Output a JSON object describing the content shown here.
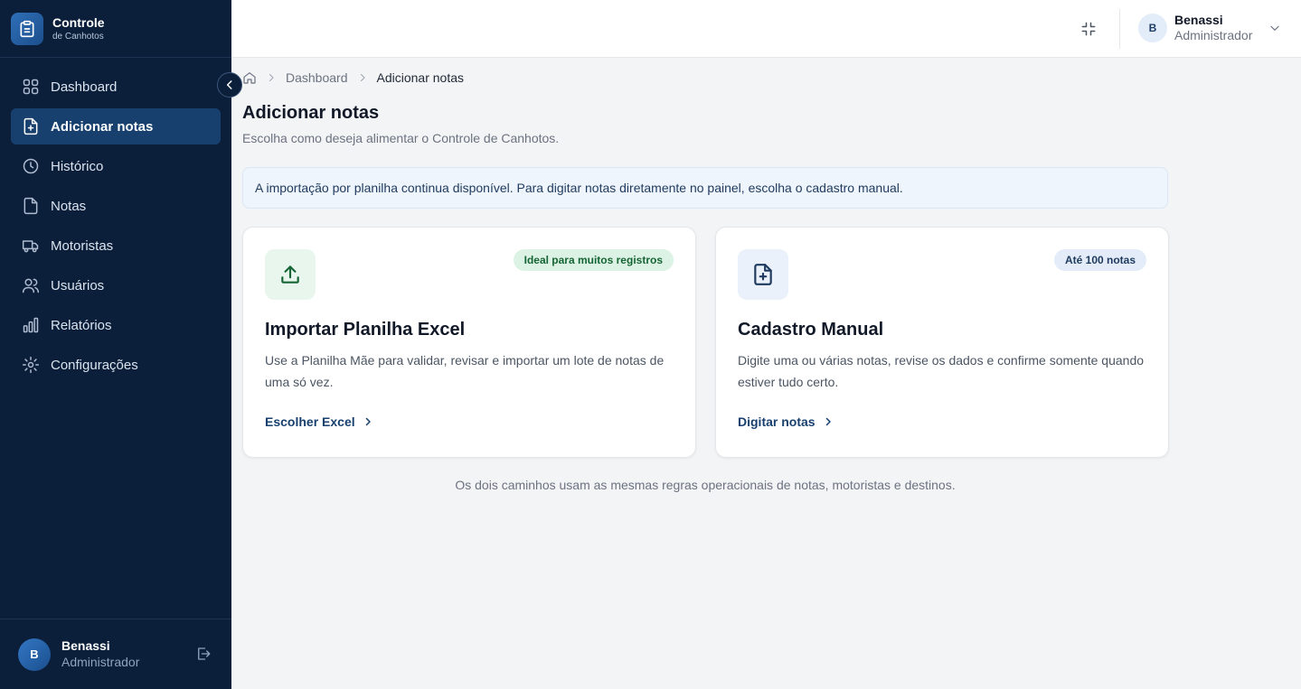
{
  "brand": {
    "title": "Controle",
    "subtitle": "de Canhotos"
  },
  "sidebar": {
    "items": [
      {
        "label": "Dashboard",
        "icon": "dashboard-icon",
        "active": false
      },
      {
        "label": "Adicionar notas",
        "icon": "file-plus-icon",
        "active": true
      },
      {
        "label": "Histórico",
        "icon": "clock-icon",
        "active": false
      },
      {
        "label": "Notas",
        "icon": "file-icon",
        "active": false
      },
      {
        "label": "Motoristas",
        "icon": "truck-icon",
        "active": false
      },
      {
        "label": "Usuários",
        "icon": "users-icon",
        "active": false
      },
      {
        "label": "Relatórios",
        "icon": "bar-chart-icon",
        "active": false
      },
      {
        "label": "Configurações",
        "icon": "gear-icon",
        "active": false
      }
    ],
    "user": {
      "initial": "B",
      "name": "Benassi",
      "role": "Administrador"
    }
  },
  "topbar": {
    "user": {
      "initial": "B",
      "name": "Benassi",
      "role": "Administrador"
    }
  },
  "breadcrumb": {
    "items": [
      "Dashboard",
      "Adicionar notas"
    ]
  },
  "page": {
    "title": "Adicionar notas",
    "subtitle": "Escolha como deseja alimentar o Controle de Canhotos."
  },
  "info_banner": "A importação por planilha continua disponível. Para digitar notas diretamente no painel, escolha o cadastro manual.",
  "cards": [
    {
      "badge": "Ideal para muitos registros",
      "title": "Importar Planilha Excel",
      "description": "Use a Planilha Mãe para validar, revisar e importar um lote de notas de uma só vez.",
      "link": "Escolher Excel",
      "icon": "upload-icon"
    },
    {
      "badge": "Até 100 notas",
      "title": "Cadastro Manual",
      "description": "Digite uma ou várias notas, revise os dados e confirme somente quando estiver tudo certo.",
      "link": "Digitar notas",
      "icon": "file-plus-icon"
    }
  ],
  "footnote": "Os dois caminhos usam as mesmas regras operacionais de notas, motoristas e destinos.",
  "colors": {
    "sidebar_bg": "#0b1f3a",
    "active_item": "#17406e",
    "link": "#17406e",
    "badge_green": "#dcf2e4",
    "badge_blue": "#e3ecf8"
  }
}
